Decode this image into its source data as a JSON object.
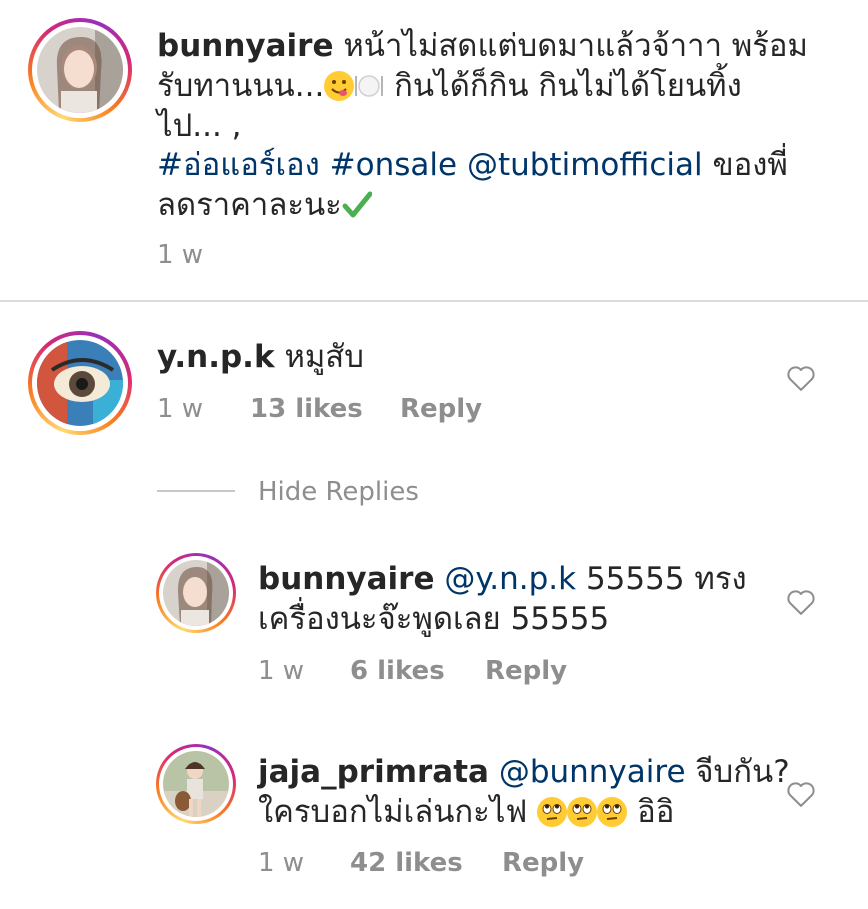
{
  "caption": {
    "username": "bunnyaire",
    "line1_text": "หน้าไม่สดแต่บดมาแล้วจ้าาา พร้อม",
    "line2_text_a": "รับทานนน...",
    "line2_text_b": " กินได้ก็กิน กินไม่ได้โยนทิ้ง",
    "line3_text": "ไป... ,",
    "hashtag1": "#อ่อแอร์เอง",
    "hashtag2": "#onsale",
    "mention": "@tubtimofficial",
    "line4_tail": " ของพี่",
    "line5_text": "ลดราคาละนะ",
    "time": "1 w",
    "emoji_icons": [
      "yum-face-icon",
      "plate-cutlery-icon",
      "check-mark-icon"
    ]
  },
  "comments": [
    {
      "username": "y.n.p.k",
      "text": "หมูสับ",
      "time": "1 w",
      "likes": "13 likes",
      "reply_label": "Reply"
    }
  ],
  "hide_replies_label": "Hide Replies",
  "replies": [
    {
      "username": "bunnyaire",
      "mention": "@y.n.p.k",
      "text_a": " 55555 ทรง",
      "text_b": "เครื่องนะจ๊ะพูดเลย 55555",
      "time": "1 w",
      "likes": "6 likes",
      "reply_label": "Reply"
    },
    {
      "username": "jaja_primrata",
      "mention": "@bunnyaire",
      "text_a": " จีบกัน?",
      "text_b": "ใครบอกไม่เล่นกะไฟ ",
      "text_c": " อิอิ",
      "time": "1 w",
      "likes": "42 likes",
      "reply_label": "Reply",
      "emoji_icons": [
        "eye-roll-face-icon",
        "eye-roll-face-icon",
        "eye-roll-face-icon"
      ]
    }
  ],
  "colors": {
    "text": "#262626",
    "meta": "#8e8e8e",
    "link": "#003569",
    "divider": "#dbdbdb"
  }
}
